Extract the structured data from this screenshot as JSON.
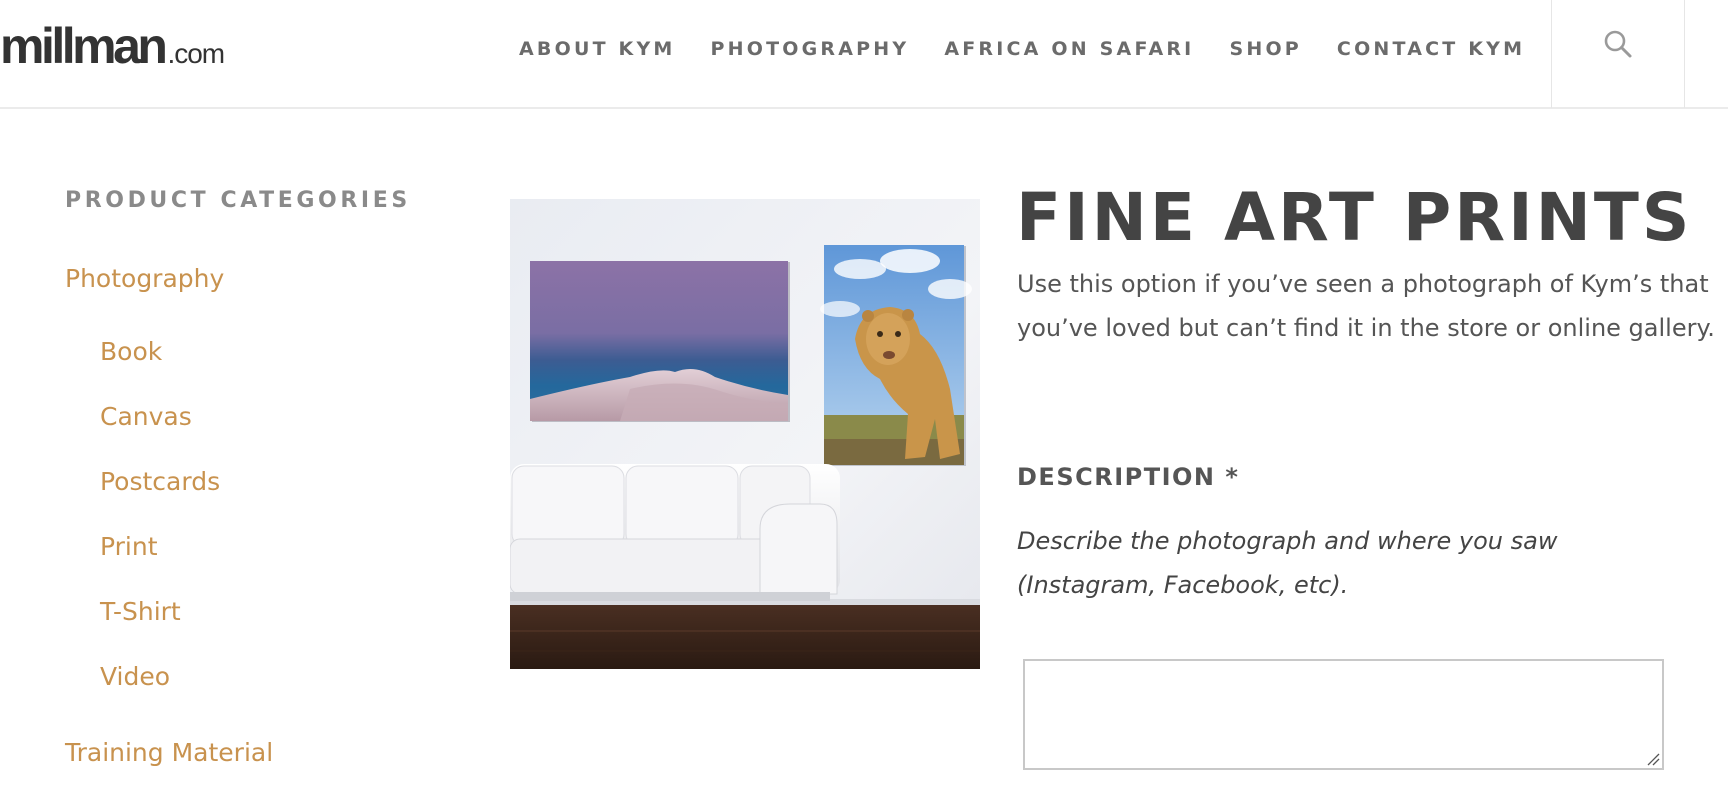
{
  "header": {
    "logo_main": "millman",
    "logo_suffix": ".com",
    "nav": [
      {
        "label": "ABOUT KYM"
      },
      {
        "label": "PHOTOGRAPHY"
      },
      {
        "label": "AFRICA ON SAFARI"
      },
      {
        "label": "SHOP"
      },
      {
        "label": "CONTACT KYM"
      }
    ],
    "search_icon": "search-icon"
  },
  "sidebar": {
    "heading": "PRODUCT CATEGORIES",
    "categories": [
      {
        "label": "Photography",
        "level": "top"
      },
      {
        "label": "Book",
        "level": "sub"
      },
      {
        "label": "Canvas",
        "level": "sub"
      },
      {
        "label": "Postcards",
        "level": "sub"
      },
      {
        "label": "Print",
        "level": "sub"
      },
      {
        "label": "T-Shirt",
        "level": "sub"
      },
      {
        "label": "Video",
        "level": "sub"
      },
      {
        "label": "Training Material",
        "level": "top"
      }
    ]
  },
  "product": {
    "title": "FINE ART PRINTS",
    "intro": "Use this option if you’ve seen a photograph of Kym’s that you’ve loved but can’t find it in the store or online gallery.",
    "description_label": "DESCRIPTION *",
    "description_hint": "Describe the photograph and where you saw (Instagram, Facebook, etc).",
    "description_value": "",
    "image_icon": "product-mockup-image"
  },
  "colors": {
    "accent": "#c8924e",
    "heading": "#444444",
    "nav_text": "#6b6b6b"
  }
}
